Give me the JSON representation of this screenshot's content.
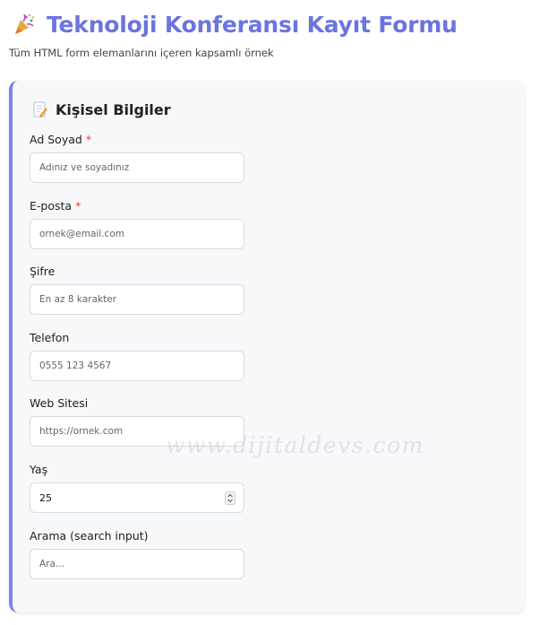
{
  "header": {
    "title": "Teknoloji Konferansı Kayıt Formu",
    "title_icon": "party-popper-icon",
    "subtitle": "Tüm HTML form elemanlarını içeren kapsamlı örnek"
  },
  "section": {
    "title": "Kişisel Bilgiler",
    "icon": "memo-icon",
    "accent_color": "#7a86e8"
  },
  "fields": {
    "name": {
      "label": "Ad Soyad",
      "required_mark": "*",
      "placeholder": "Adınız ve soyadınız"
    },
    "email": {
      "label": "E-posta",
      "required_mark": "*",
      "placeholder": "ornek@email.com"
    },
    "password": {
      "label": "Şifre",
      "placeholder": "En az 8 karakter"
    },
    "phone": {
      "label": "Telefon",
      "placeholder": "0555 123 4567"
    },
    "website": {
      "label": "Web Sitesi",
      "placeholder": "https://ornek.com"
    },
    "age": {
      "label": "Yaş",
      "value": "25"
    },
    "search": {
      "label": "Arama (search input)",
      "placeholder": "Ara..."
    }
  },
  "watermark": "www.dijitaldevs.com",
  "colors": {
    "title": "#6b74e0",
    "required": "#e0453a"
  }
}
